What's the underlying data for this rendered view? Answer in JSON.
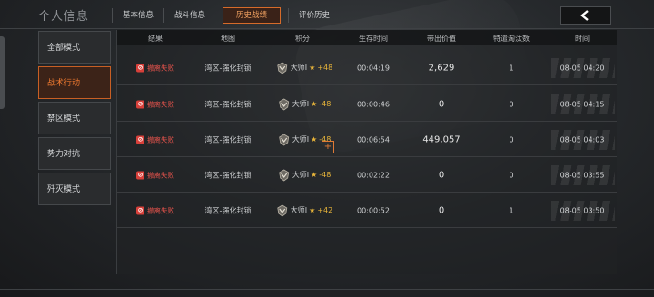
{
  "header": {
    "title": "个人信息",
    "tabs": [
      {
        "label": "基本信息"
      },
      {
        "label": "战斗信息"
      },
      {
        "label": "历史战绩"
      },
      {
        "label": "评价历史"
      }
    ],
    "active_tab": "历史战绩"
  },
  "sidebar": {
    "items": [
      {
        "label": "全部模式"
      },
      {
        "label": "战术行动"
      },
      {
        "label": "禁区模式"
      },
      {
        "label": "势力对抗"
      },
      {
        "label": "歼灭模式"
      }
    ],
    "active": "战术行动"
  },
  "table": {
    "columns": [
      "结果",
      "地图",
      "积分",
      "生存时间",
      "带出价值",
      "特遣淘汰数",
      "时间"
    ],
    "rows": [
      {
        "result": "撤离失败",
        "map": "湾区-强化封锁",
        "rank": "大师I",
        "delta": "+48",
        "survival": "00:04:19",
        "value": "2,629",
        "kills": "1",
        "time": "08-05 04:20"
      },
      {
        "result": "撤离失败",
        "map": "湾区-强化封锁",
        "rank": "大师I",
        "delta": "-48",
        "survival": "00:00:46",
        "value": "0",
        "kills": "0",
        "time": "08-05 04:15"
      },
      {
        "result": "撤离失败",
        "map": "湾区-强化封锁",
        "rank": "大师I",
        "delta": "-48",
        "survival": "00:06:54",
        "value": "449,057",
        "kills": "0",
        "time": "08-05 04:03"
      },
      {
        "result": "撤离失败",
        "map": "湾区-强化封锁",
        "rank": "大师I",
        "delta": "-48",
        "survival": "00:02:22",
        "value": "0",
        "kills": "0",
        "time": "08-05 03:55"
      },
      {
        "result": "撤离失败",
        "map": "湾区-强化封锁",
        "rank": "大师I",
        "delta": "+42",
        "survival": "00:00:52",
        "value": "0",
        "kills": "1",
        "time": "08-05 03:50"
      }
    ]
  },
  "expand_label": "+",
  "colors": {
    "accent": "#e07a35",
    "fail": "#e2524b",
    "star": "#e7b43a"
  },
  "icons": {
    "back": "chevron-left-icon",
    "result": "fail-icon",
    "rank": "rank-badge-icon"
  }
}
